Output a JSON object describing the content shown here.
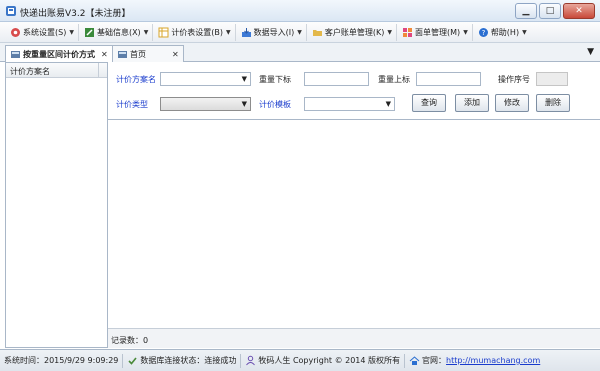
{
  "window": {
    "title": "快递出账易V3.2【未注册】",
    "minimize": "▁",
    "maximize": "□",
    "close": "✕"
  },
  "menubar": [
    {
      "label": "系统设置(S)",
      "icon": "gear-icon",
      "color": "#d84c4c"
    },
    {
      "label": "基础信息(X)",
      "icon": "edit-icon",
      "color": "#3b8a3b"
    },
    {
      "label": "计价表设置(B)",
      "icon": "table-icon",
      "color": "#d9a52a"
    },
    {
      "label": "数据导入(I)",
      "icon": "import-icon",
      "color": "#3d7ad6"
    },
    {
      "label": "客户账单管理(K)",
      "icon": "folder-icon",
      "color": "#e3b84a"
    },
    {
      "label": "面单管理(M)",
      "icon": "waybill-icon",
      "color": "#e0477f"
    },
    {
      "label": "帮助(H)",
      "icon": "help-icon",
      "color": "#2b6fd1"
    }
  ],
  "tabs": [
    {
      "label": "按重量区间计价方式",
      "active": true
    },
    {
      "label": "首页",
      "active": false
    }
  ],
  "left_pane": {
    "header": "计价方案名"
  },
  "form": {
    "scheme_name_label": "计价方案名",
    "weight_lower_label": "重量下标",
    "weight_upper_label": "重量上标",
    "op_seq_label": "操作序号",
    "pricing_type_label": "计价类型",
    "pricing_template_label": "计价模板",
    "scheme_name_value": "",
    "weight_lower_value": "",
    "weight_upper_value": "",
    "op_seq_value": "",
    "pricing_type_value": "",
    "pricing_template_value": "",
    "buttons": {
      "query": "查询",
      "add": "添加",
      "edit": "修改",
      "delete": "删除"
    }
  },
  "records": {
    "label": "记录数：",
    "count": "0"
  },
  "status": {
    "system_time": "系统时间：2015/9/29 9:09:29",
    "db_status": "数据库连接状态：连接成功",
    "copyright": "牧码人生 Copyright © 2014 版权所有",
    "website_label": "官网：",
    "website_url": "http://mumachang.com"
  },
  "colors": {
    "accent_blue": "#1a3ccd",
    "border": "#a9b7c8"
  }
}
